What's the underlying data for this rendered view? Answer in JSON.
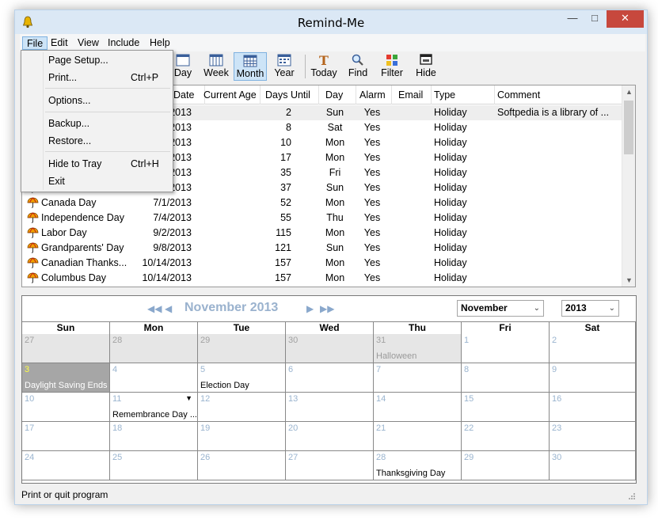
{
  "window": {
    "title": "Remind-Me"
  },
  "menubar": {
    "items": [
      "File",
      "Edit",
      "View",
      "Include",
      "Help"
    ]
  },
  "toolbar": {
    "day": "Day",
    "week": "Week",
    "month": "Month",
    "year": "Year",
    "today": "Today",
    "find": "Find",
    "filter": "Filter",
    "hide": "Hide"
  },
  "file_menu": {
    "page_setup": "Page Setup...",
    "print": "Print...",
    "print_shortcut": "Ctrl+P",
    "options": "Options...",
    "backup": "Backup...",
    "restore": "Restore...",
    "hide_to_tray": "Hide to Tray",
    "hide_shortcut": "Ctrl+H",
    "exit": "Exit"
  },
  "list": {
    "headers": {
      "date": "Date",
      "current_age": "Current Age",
      "days_until": "Days Until",
      "day": "Day",
      "alarm": "Alarm",
      "email": "Email",
      "type": "Type",
      "comment": "Comment"
    },
    "rows": [
      {
        "name": "",
        "date": "2013",
        "days": "2",
        "day": "Sun",
        "alarm": "Yes",
        "type": "Holiday",
        "comment": "Softpedia is a library of ..."
      },
      {
        "name": "",
        "date": "2013",
        "days": "8",
        "day": "Sat",
        "alarm": "Yes",
        "type": "Holiday",
        "comment": ""
      },
      {
        "name": "",
        "date": "2013",
        "days": "10",
        "day": "Mon",
        "alarm": "Yes",
        "type": "Holiday",
        "comment": ""
      },
      {
        "name": "",
        "date": "2013",
        "days": "17",
        "day": "Mon",
        "alarm": "Yes",
        "type": "Holiday",
        "comment": ""
      },
      {
        "name": "",
        "date": "2013",
        "days": "35",
        "day": "Fri",
        "alarm": "Yes",
        "type": "Holiday",
        "comment": ""
      },
      {
        "name": "",
        "date": "2013",
        "days": "37",
        "day": "Sun",
        "alarm": "Yes",
        "type": "Holiday",
        "comment": ""
      },
      {
        "name": "Canada Day",
        "date": "7/1/2013",
        "days": "52",
        "day": "Mon",
        "alarm": "Yes",
        "type": "Holiday",
        "comment": ""
      },
      {
        "name": "Independence Day",
        "date": "7/4/2013",
        "days": "55",
        "day": "Thu",
        "alarm": "Yes",
        "type": "Holiday",
        "comment": ""
      },
      {
        "name": "Labor Day",
        "date": "9/2/2013",
        "days": "115",
        "day": "Mon",
        "alarm": "Yes",
        "type": "Holiday",
        "comment": ""
      },
      {
        "name": "Grandparents' Day",
        "date": "9/8/2013",
        "days": "121",
        "day": "Sun",
        "alarm": "Yes",
        "type": "Holiday",
        "comment": ""
      },
      {
        "name": "Canadian Thanks...",
        "date": "10/14/2013",
        "days": "157",
        "day": "Mon",
        "alarm": "Yes",
        "type": "Holiday",
        "comment": ""
      },
      {
        "name": "Columbus Day",
        "date": "10/14/2013",
        "days": "157",
        "day": "Mon",
        "alarm": "Yes",
        "type": "Holiday",
        "comment": ""
      }
    ]
  },
  "calendar": {
    "title": "November 2013",
    "month_select": "November",
    "year_select": "2013",
    "weekdays": [
      "Sun",
      "Mon",
      "Tue",
      "Wed",
      "Thu",
      "Fri",
      "Sat"
    ],
    "weeks": [
      [
        {
          "n": "27",
          "o": true
        },
        {
          "n": "28",
          "o": true
        },
        {
          "n": "29",
          "o": true
        },
        {
          "n": "30",
          "o": true
        },
        {
          "n": "31",
          "o": true,
          "e": "Halloween"
        },
        {
          "n": "1"
        },
        {
          "n": "2"
        }
      ],
      [
        {
          "n": "3",
          "s": true,
          "e": "Daylight Saving Ends"
        },
        {
          "n": "4"
        },
        {
          "n": "5",
          "e": "Election Day"
        },
        {
          "n": "6"
        },
        {
          "n": "7"
        },
        {
          "n": "8"
        },
        {
          "n": "9"
        }
      ],
      [
        {
          "n": "10"
        },
        {
          "n": "11",
          "e": "Remembrance Day ...",
          "m": true
        },
        {
          "n": "12"
        },
        {
          "n": "13"
        },
        {
          "n": "14"
        },
        {
          "n": "15"
        },
        {
          "n": "16"
        }
      ],
      [
        {
          "n": "17"
        },
        {
          "n": "18"
        },
        {
          "n": "19"
        },
        {
          "n": "20"
        },
        {
          "n": "21"
        },
        {
          "n": "22"
        },
        {
          "n": "23"
        }
      ],
      [
        {
          "n": "24"
        },
        {
          "n": "25"
        },
        {
          "n": "26"
        },
        {
          "n": "27"
        },
        {
          "n": "28",
          "e": "Thanksgiving Day"
        },
        {
          "n": "29"
        },
        {
          "n": "30"
        }
      ]
    ]
  },
  "status": {
    "text": "Print or quit program"
  },
  "colors": {
    "title_bar": "#dbe8f5",
    "close": "#c7483d",
    "selection": "#cde4f7",
    "month_title": "#9ab2ce"
  }
}
